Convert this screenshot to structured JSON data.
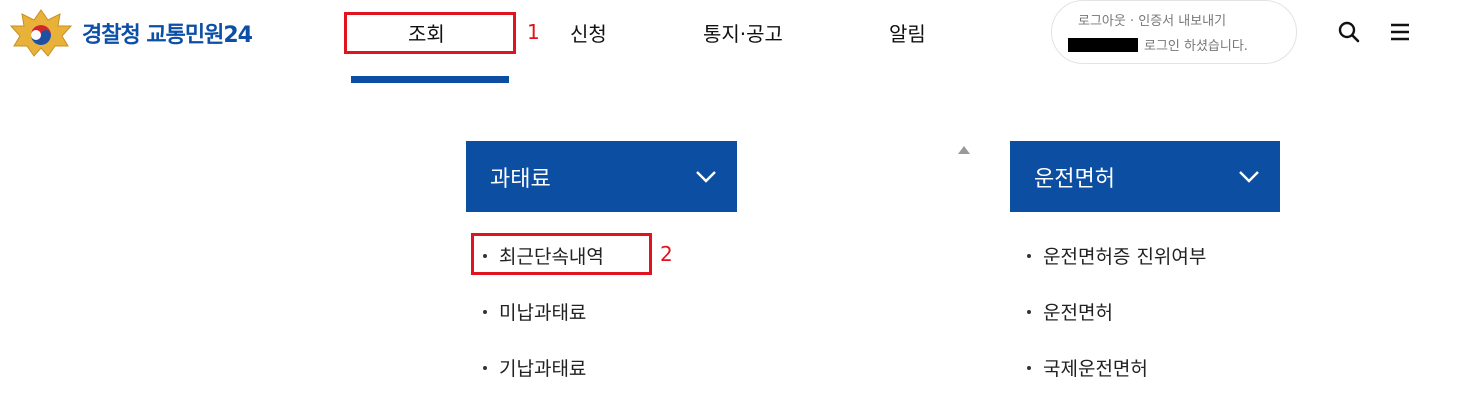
{
  "brand": {
    "org": "경찰청",
    "service": "교통민원24"
  },
  "nav": {
    "items": [
      "조회",
      "신청",
      "통지·공고",
      "알림"
    ]
  },
  "annotations": {
    "num1": "1",
    "num2": "2"
  },
  "login": {
    "top_text": "로그아웃 · 인증서 내보내기",
    "bottom_text": "로그인 하셨습니다."
  },
  "icons": {
    "search": "search-icon",
    "menu": "hamburger-menu-icon",
    "chevron": "chevron-down-icon"
  },
  "menu": {
    "categories": [
      {
        "title": "과태료",
        "items": [
          "최근단속내역",
          "미납과태료",
          "기납과태료"
        ]
      },
      {
        "title": "운전면허",
        "items": [
          "운전면허증 진위여부",
          "운전면허",
          "국제운전면허"
        ]
      }
    ]
  },
  "colors": {
    "primary": "#0b4ea2",
    "highlight": "#e0141e"
  }
}
